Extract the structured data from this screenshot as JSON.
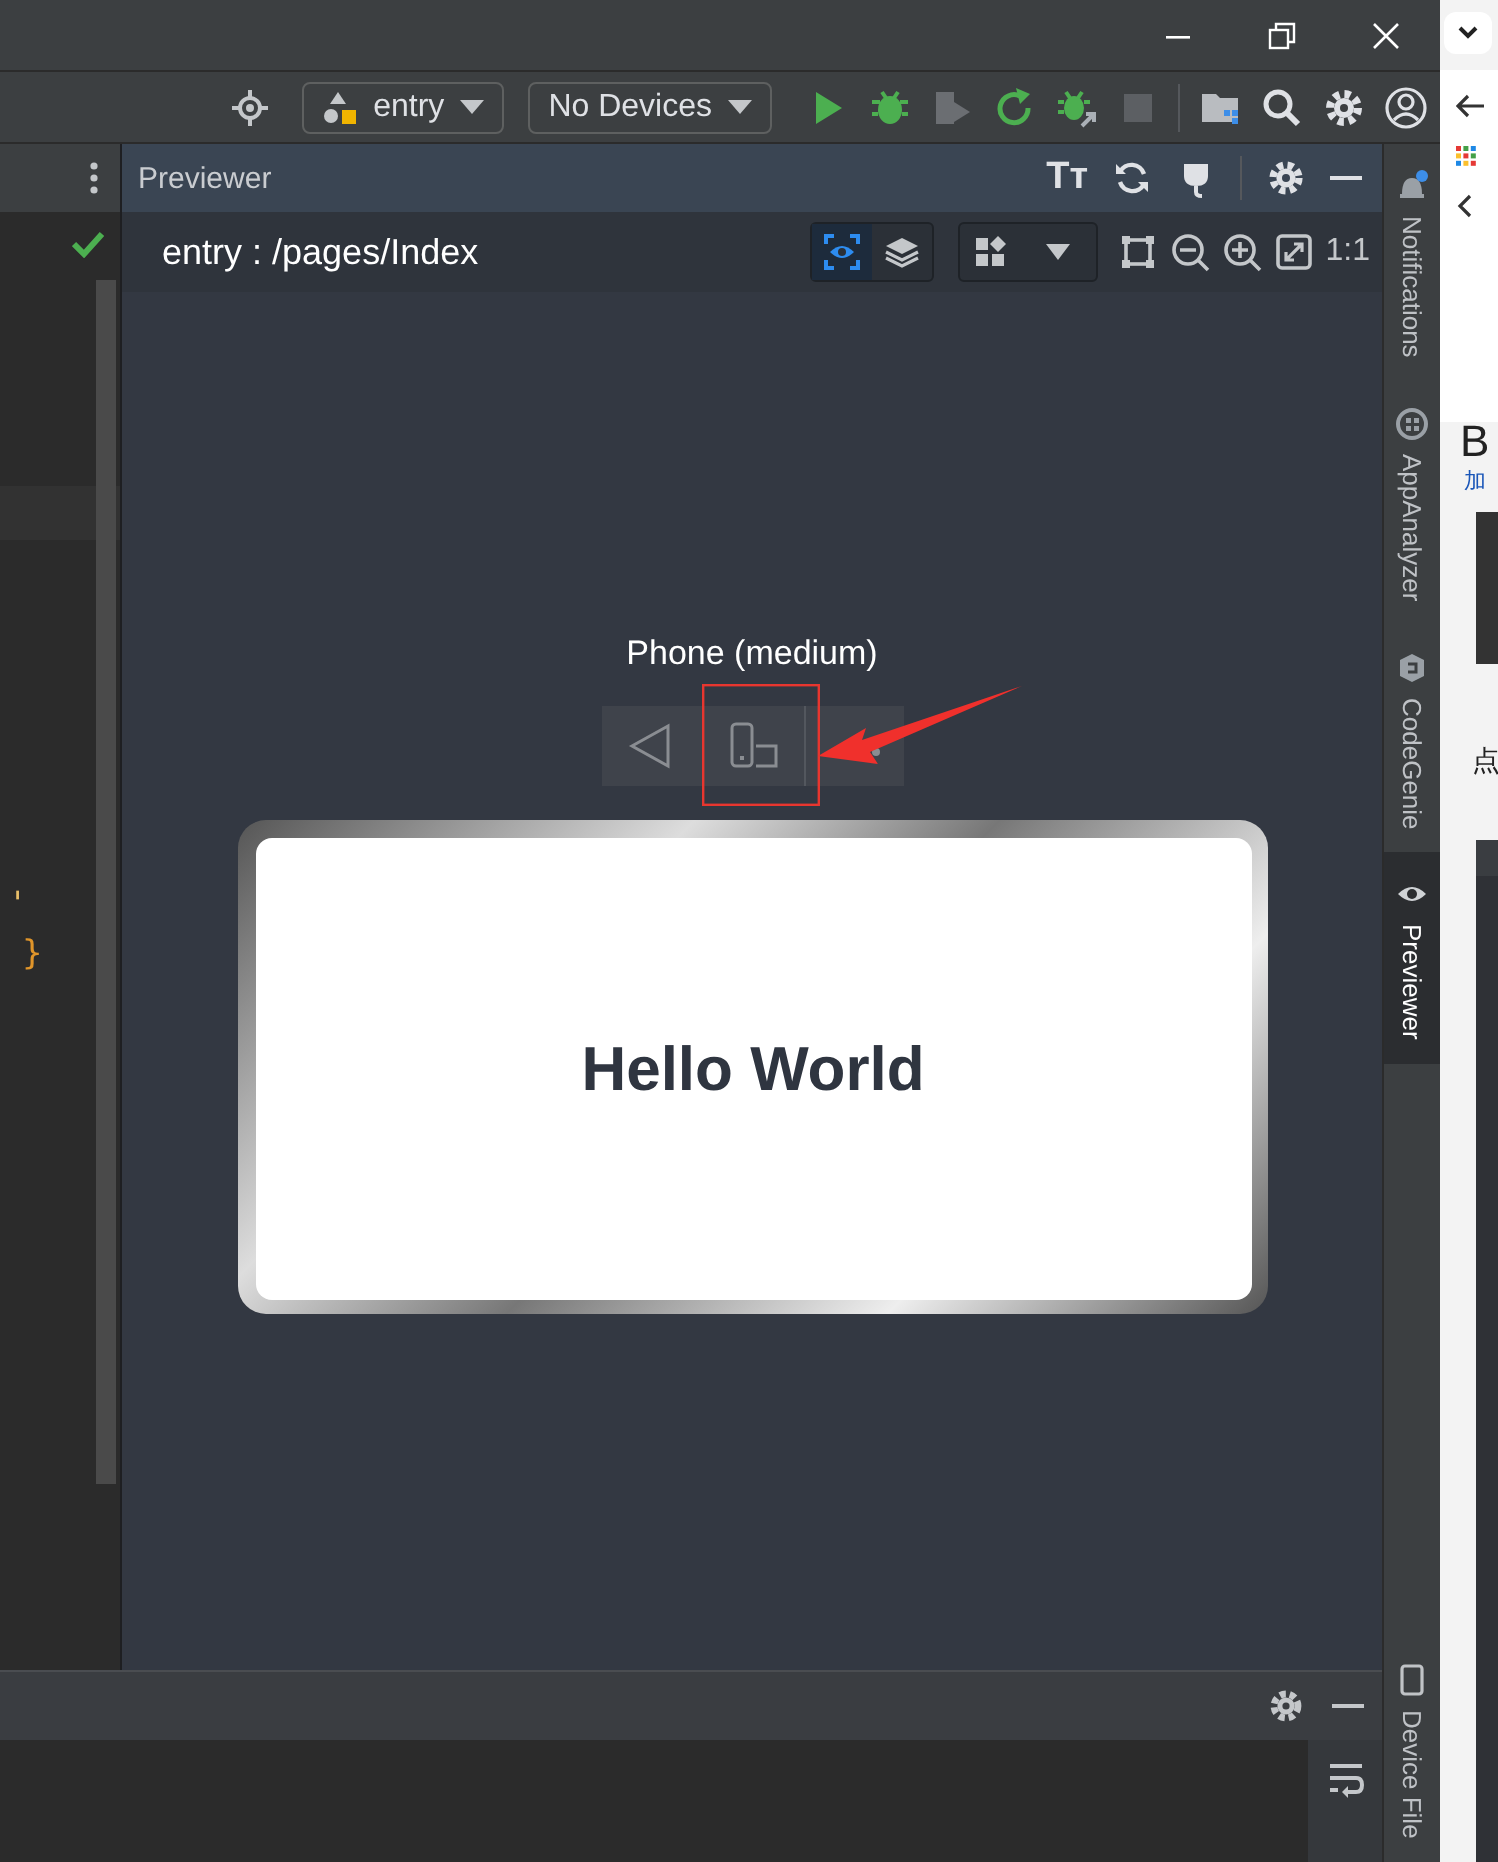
{
  "toolbar": {
    "module": "entry",
    "device": "No Devices"
  },
  "editor": {
    "snippets": [
      "'",
      "}"
    ]
  },
  "previewer": {
    "title": "Previewer",
    "text_size_button": "Tт",
    "page": "entry : /pages/Index",
    "scale_button": "1:1",
    "device_name": "Phone (medium)",
    "content": "Hello World"
  },
  "tool_windows": [
    {
      "label": "Notifications",
      "kind": "bell",
      "selected": false
    },
    {
      "label": "AppAnalyzer",
      "kind": "analyzer",
      "selected": false
    },
    {
      "label": "CodeGenie",
      "kind": "genie",
      "selected": false
    },
    {
      "label": "Previewer",
      "kind": "eye",
      "selected": true
    }
  ],
  "bottom_tool_windows": [
    {
      "label": "Device File",
      "kind": "device",
      "selected": false
    }
  ],
  "browser_strip": {
    "texts": [
      "B",
      "加",
      "点"
    ]
  }
}
